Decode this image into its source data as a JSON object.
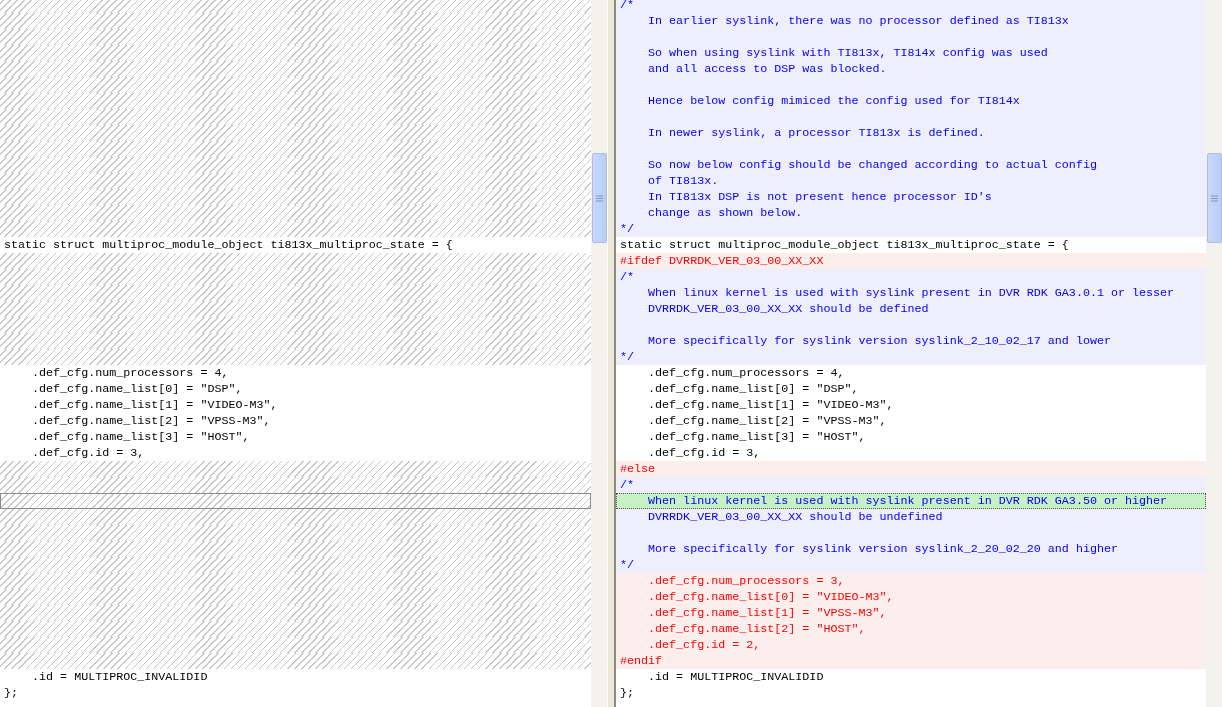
{
  "rows": [
    {
      "kind": "comment",
      "right": "/*",
      "selected": false
    },
    {
      "kind": "comment",
      "right": "    In earlier syslink, there was no processor defined as TI813x",
      "selected": false
    },
    {
      "kind": "comment",
      "selected": false
    },
    {
      "kind": "comment",
      "right": "    So when using syslink with TI813x, TI814x config was used",
      "selected": false
    },
    {
      "kind": "comment",
      "right": "    and all access to DSP was blocked.",
      "selected": false
    },
    {
      "kind": "comment",
      "selected": false
    },
    {
      "kind": "comment",
      "right": "    Hence below config mimiced the config used for TI814x",
      "selected": false
    },
    {
      "kind": "comment",
      "selected": false
    },
    {
      "kind": "comment",
      "right": "    In newer syslink, a processor TI813x is defined.",
      "selected": false
    },
    {
      "kind": "comment",
      "selected": false
    },
    {
      "kind": "comment",
      "right": "    So now below config should be changed according to actual config",
      "selected": false
    },
    {
      "kind": "comment",
      "right": "    of TI813x.",
      "selected": false
    },
    {
      "kind": "comment",
      "right": "    In TI813x DSP is not present hence processor ID's",
      "selected": false
    },
    {
      "kind": "comment",
      "right": "    change as shown below.",
      "selected": false
    },
    {
      "kind": "comment",
      "right": "*/",
      "selected": false
    },
    {
      "kind": "plain",
      "left": "static struct multiproc_module_object ti813x_multiproc_state = {",
      "right": "static struct multiproc_module_object ti813x_multiproc_state = {",
      "selected": false
    },
    {
      "kind": "changed",
      "right": "#ifdef DVRRDK_VER_03_00_XX_XX",
      "selected": false
    },
    {
      "kind": "comment",
      "right": "/*",
      "selected": false
    },
    {
      "kind": "comment",
      "right": "    When linux kernel is used with syslink present in DVR RDK GA3.0.1 or lesser",
      "selected": false
    },
    {
      "kind": "comment",
      "right": "    DVRRDK_VER_03_00_XX_XX should be defined",
      "selected": false
    },
    {
      "kind": "comment",
      "selected": false
    },
    {
      "kind": "comment",
      "right": "    More specifically for syslink version syslink_2_10_02_17 and lower",
      "selected": false
    },
    {
      "kind": "comment",
      "right": "*/",
      "selected": false
    },
    {
      "kind": "plain",
      "left": "    .def_cfg.num_processors = 4,",
      "right": "    .def_cfg.num_processors = 4,",
      "selected": false
    },
    {
      "kind": "plain",
      "left": "    .def_cfg.name_list[0] = \"DSP\",",
      "right": "    .def_cfg.name_list[0] = \"DSP\",",
      "selected": false
    },
    {
      "kind": "plain",
      "left": "    .def_cfg.name_list[1] = \"VIDEO-M3\",",
      "right": "    .def_cfg.name_list[1] = \"VIDEO-M3\",",
      "selected": false
    },
    {
      "kind": "plain",
      "left": "    .def_cfg.name_list[2] = \"VPSS-M3\",",
      "right": "    .def_cfg.name_list[2] = \"VPSS-M3\",",
      "selected": false
    },
    {
      "kind": "plain",
      "left": "    .def_cfg.name_list[3] = \"HOST\",",
      "right": "    .def_cfg.name_list[3] = \"HOST\",",
      "selected": false
    },
    {
      "kind": "plain",
      "left": "    .def_cfg.id = 3,",
      "right": "    .def_cfg.id = 3,",
      "selected": false
    },
    {
      "kind": "changed",
      "right": "#else",
      "selected": false
    },
    {
      "kind": "comment",
      "right": "/*",
      "selected": false
    },
    {
      "kind": "comment",
      "right": "    When linux kernel is used with syslink present in DVR RDK GA3.50 or higher",
      "selected": true
    },
    {
      "kind": "comment",
      "right": "    DVRRDK_VER_03_00_XX_XX should be undefined",
      "selected": false
    },
    {
      "kind": "comment",
      "selected": false
    },
    {
      "kind": "comment",
      "right": "    More specifically for syslink version syslink_2_20_02_20 and higher",
      "selected": false
    },
    {
      "kind": "comment",
      "right": "*/",
      "selected": false
    },
    {
      "kind": "changed",
      "right": "    .def_cfg.num_processors = 3,",
      "selected": false
    },
    {
      "kind": "changed",
      "right": "    .def_cfg.name_list[0] = \"VIDEO-M3\",",
      "selected": false
    },
    {
      "kind": "changed",
      "right": "    .def_cfg.name_list[1] = \"VPSS-M3\",",
      "selected": false
    },
    {
      "kind": "changed",
      "right": "    .def_cfg.name_list[2] = \"HOST\",",
      "selected": false
    },
    {
      "kind": "changed",
      "right": "    .def_cfg.id = 2,",
      "selected": false
    },
    {
      "kind": "changed",
      "right": "#endif",
      "selected": false
    },
    {
      "kind": "plain",
      "left": "    .id = MULTIPROC_INVALIDID",
      "right": "    .id = MULTIPROC_INVALIDID",
      "selected": false
    },
    {
      "kind": "plain",
      "left": "};",
      "right": "};",
      "selected": false
    }
  ]
}
